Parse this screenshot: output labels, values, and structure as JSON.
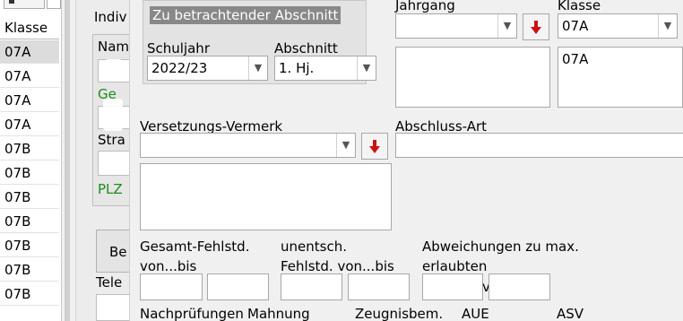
{
  "class_list": {
    "header": "Klasse",
    "rows": [
      "07A",
      "07A",
      "07A",
      "07A",
      "07B",
      "07B",
      "07B",
      "07B",
      "07B",
      "07B",
      "07B"
    ],
    "selected_index": 0
  },
  "background": {
    "indiv_label": "Indiv",
    "nam_label": "Nam",
    "ge_label": "Ge",
    "stra_label": "Stra",
    "plz_label": "PLZ",
    "be_label": "Be",
    "tele_label": "Tele"
  },
  "modal": {
    "section_title": "Zu betrachtender Abschnitt",
    "schuljahr_label": "Schuljahr",
    "schuljahr_value": "2022/23",
    "abschnitt_label": "Abschnitt",
    "abschnitt_value": "1. Hj.",
    "jahrgang_label": "Jahrgang",
    "jahrgang_value": "",
    "klasse_label": "Klasse",
    "klasse_value": "07A",
    "klasse_list_value": "07A",
    "versetzung_label": "Versetzungs-Vermerk",
    "versetzung_value": "",
    "abschluss_label": "Abschluss-Art",
    "abschluss_value": "",
    "gesamt_label_1": "Gesamt-Fehlstd.",
    "gesamt_label_2": "von...bis",
    "unentsch_label_1": "unentsch.",
    "unentsch_label_2": "Fehlstd. von...bis",
    "abweichung_label_1": "Abweichungen zu max.",
    "abweichung_label_2": "erlaubten",
    "abweichung_sep": "v",
    "nachpruefungen_label": "Nachprüfungen",
    "mahnung_label": "Mahnung",
    "zeugnisbem_label": "Zeugnisbem.",
    "aue_label": "AUE",
    "asv_label": "ASV"
  },
  "colors": {
    "accent_red": "#cc1111",
    "green_label": "#1a8c1a",
    "legend_bg": "#888888"
  }
}
